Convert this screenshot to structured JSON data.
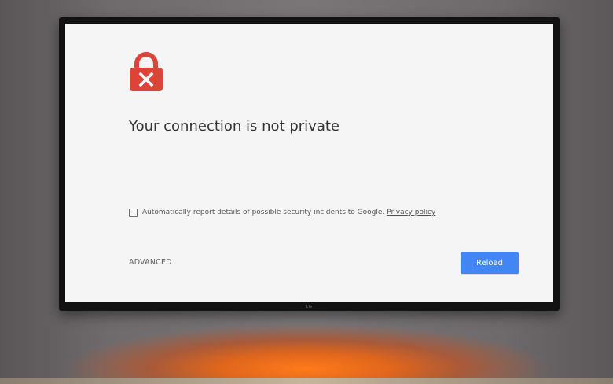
{
  "interstitial": {
    "title": "Your connection is not private",
    "report_checkbox_checked": false,
    "report_text": "Automatically report details of possible security incidents to Google.",
    "privacy_link": "Privacy policy",
    "advanced_label": "ADVANCED",
    "reload_label": "Reload",
    "icon": "lock-error-icon"
  },
  "tv": {
    "brand_logo": "LG"
  },
  "colors": {
    "accent_button": "#4285f4",
    "lock_icon": "#db4437",
    "page_background": "#f5f5f5",
    "ambient_glow": "#ff7a1a"
  }
}
